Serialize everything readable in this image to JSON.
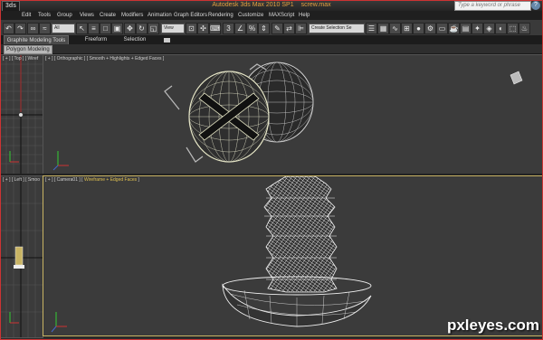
{
  "window": {
    "app_title": "Autodesk 3ds Max  2010 SP1",
    "file_name": "screw.max",
    "app_badge": "3ds",
    "search_placeholder": "Type a keyword or phrase",
    "help_glyph": "?"
  },
  "menu": [
    "Edit",
    "Tools",
    "Group",
    "Views",
    "Create",
    "Modifiers",
    "Animation",
    "Graph Editors",
    "Rendering",
    "Customize",
    "MAXScript",
    "Help"
  ],
  "toolbar": {
    "selection_filter": "All",
    "ref_coord": "View",
    "named_selection": "Create Selection Se"
  },
  "ribbon": {
    "tabs": [
      "Graphite Modeling Tools",
      "Freeform",
      "Selection"
    ],
    "panel_label": "Polygon Modeling"
  },
  "viewports": {
    "top": "[ + ] [ Top ] [ Wiref",
    "perspective": "[ + ] [ Orthographic ] [ Smooth + Highlights + Edged Faces ]",
    "left": "[ + ] [ Left ] [ Smoo",
    "camera_prefix": "[ + ] [ Camera01 ] [ ",
    "camera_mode": "Wireframe + Edged Faces",
    "camera_suffix": " ]"
  },
  "watermark": "pxleyes.com"
}
